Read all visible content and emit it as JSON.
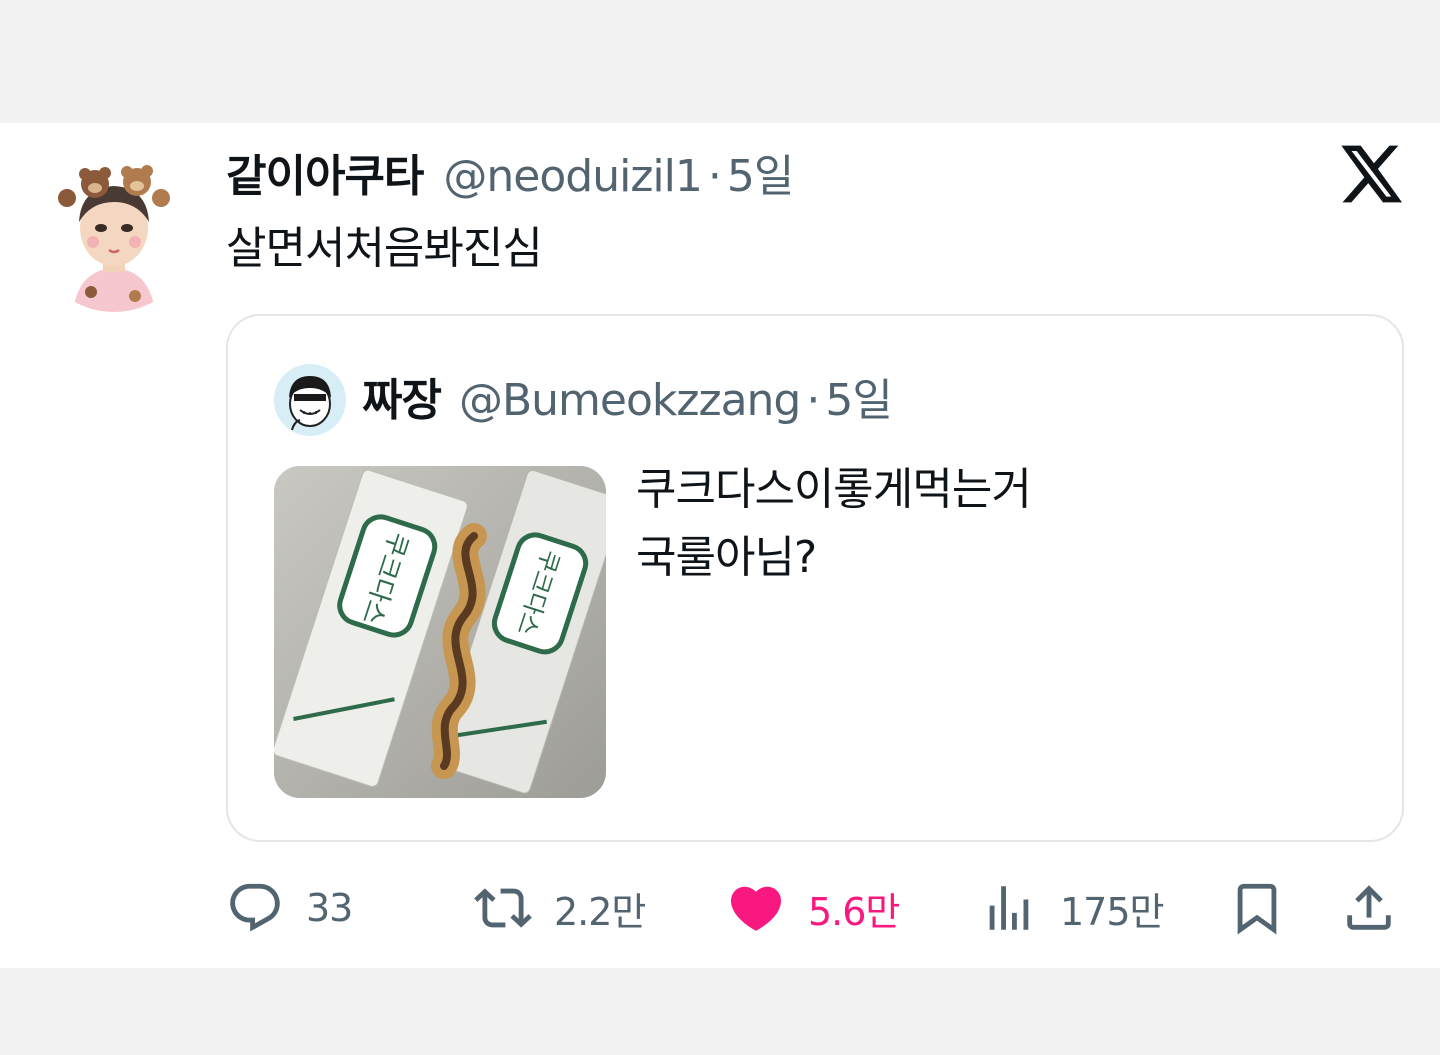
{
  "tweet": {
    "author": {
      "display_name": "같이아쿠타",
      "handle": "@neoduizil1",
      "avatar": "avatar-image"
    },
    "separator": "·",
    "time": "5일",
    "text": "살면서처음봐진심",
    "logo_icon": "x-logo-icon"
  },
  "quote": {
    "author": {
      "display_name": "짜장",
      "handle": "@Bumeokzzang",
      "avatar": "avatar-image"
    },
    "separator": "·",
    "time": "5일",
    "text_lines": [
      "쿠크다스이롷게먹는거",
      "국룰아님?"
    ],
    "media": "photo-of-couque-dasse-coffee-wafer-packs"
  },
  "actions": {
    "replies": "33",
    "retweets": "2.2만",
    "likes": "5.6만",
    "views": "175만"
  },
  "colors": {
    "text_primary": "#0f1419",
    "text_secondary": "#536471",
    "like_active": "#f91880",
    "border": "#e3e6e9",
    "background_band": "#f2f2f3"
  }
}
